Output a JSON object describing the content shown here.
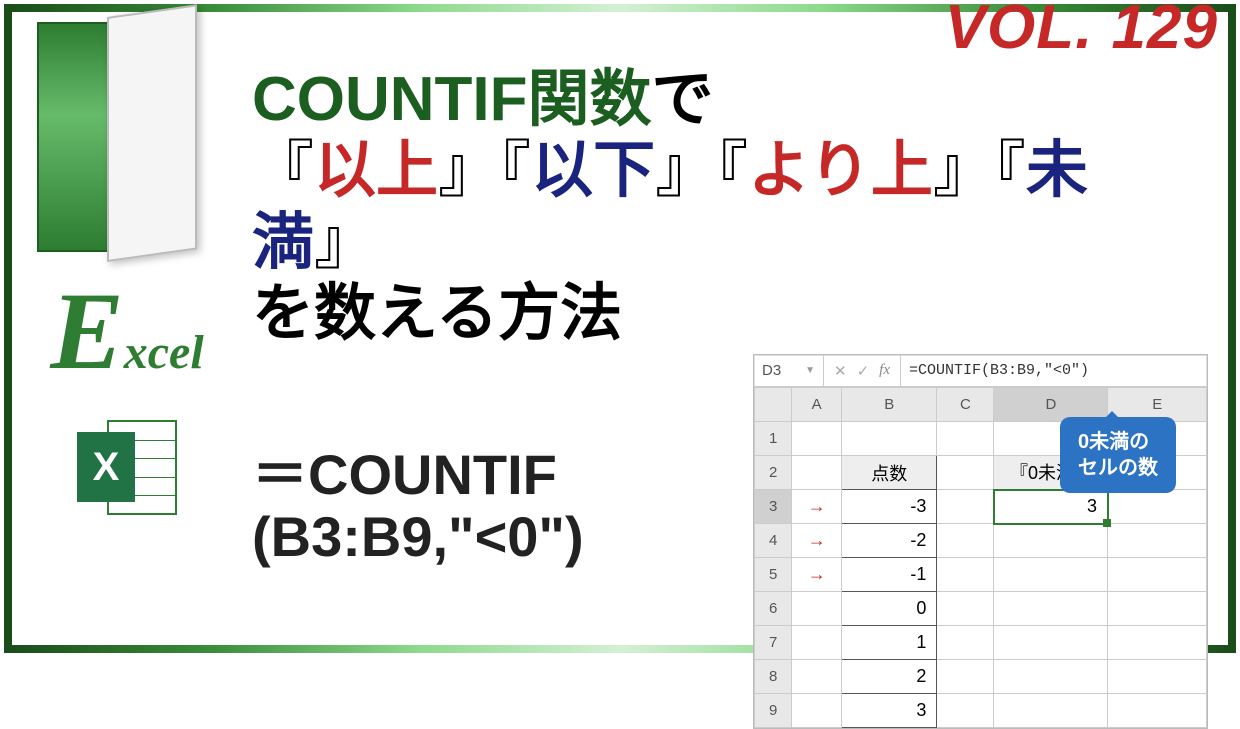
{
  "volume": "VOL. 129",
  "headline": {
    "p1_green": "COUNTIF関数",
    "p1_suffix": "で",
    "kw1": "以上",
    "kw2": "以下",
    "kw3": "より上",
    "kw4": "未満",
    "p3": "を数える方法"
  },
  "sidebar": {
    "logo_e": "E",
    "logo_rest": "xcel",
    "icon_letter": "X"
  },
  "formula_display": {
    "line1": "＝COUNTIF",
    "line2": "(B3:B9,\"<0\")"
  },
  "sheet": {
    "name_box": "D3",
    "fx_label": "fx",
    "formula_bar": "=COUNTIF(B3:B9,\"<0\")",
    "cols": [
      "A",
      "B",
      "C",
      "D",
      "E"
    ],
    "rows": [
      "1",
      "2",
      "3",
      "4",
      "5",
      "6",
      "7",
      "8",
      "9"
    ],
    "header_b": "点数",
    "header_d": "『0未満』",
    "result_d3": "3",
    "values_b": [
      "-3",
      "-2",
      "-1",
      "0",
      "1",
      "2",
      "3"
    ],
    "arrow": "→"
  },
  "callout": {
    "line1": "0未満の",
    "line2": "セルの数"
  }
}
